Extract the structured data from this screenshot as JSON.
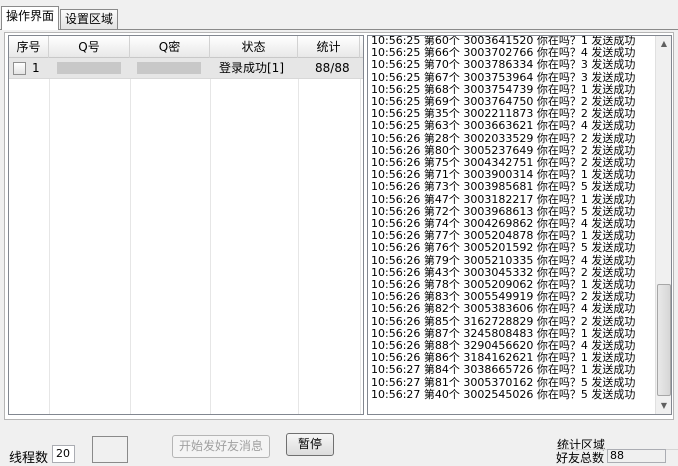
{
  "tabs": [
    {
      "label": "操作界面"
    },
    {
      "label": "设置区域"
    }
  ],
  "table": {
    "columns": [
      "序号",
      "Q号",
      "Q密",
      "状态",
      "统计"
    ],
    "rows": [
      {
        "index": "1",
        "status": "登录成功[1]",
        "count": "88/88"
      }
    ]
  },
  "log": {
    "lines": [
      "10:56:25 第60个 3003641520 你在吗？1 发送成功",
      "10:56:25 第66个 3003702766 你在吗？4 发送成功",
      "10:56:25 第70个 3003786334 你在吗？3 发送成功",
      "10:56:25 第67个 3003753964 你在吗？3 发送成功",
      "10:56:25 第68个 3003754739 你在吗？1 发送成功",
      "10:56:25 第69个 3003764750 你在吗？2 发送成功",
      "10:56:25 第35个 3002211873 你在吗？2 发送成功",
      "10:56:25 第63个 3003663621 你在吗？4 发送成功",
      "10:56:26 第28个 3002033529 你在吗？2 发送成功",
      "10:56:26 第80个 3005237649 你在吗？2 发送成功",
      "10:56:26 第75个 3004342751 你在吗？2 发送成功",
      "10:56:26 第71个 3003900314 你在吗？1 发送成功",
      "10:56:26 第73个 3003985681 你在吗？5 发送成功",
      "10:56:26 第47个 3003182217 你在吗？1 发送成功",
      "10:56:26 第72个 3003968613 你在吗？5 发送成功",
      "10:56:26 第74个 3004269862 你在吗？4 发送成功",
      "10:56:26 第77个 3005204878 你在吗？1 发送成功",
      "10:56:26 第76个 3005201592 你在吗？5 发送成功",
      "10:56:26 第79个 3005210335 你在吗？4 发送成功",
      "10:56:26 第43个 3003045332 你在吗？2 发送成功",
      "10:56:26 第78个 3005209062 你在吗？1 发送成功",
      "10:56:26 第83个 3005549919 你在吗？2 发送成功",
      "10:56:26 第82个 3005383606 你在吗？4 发送成功",
      "10:56:26 第85个 3162728829 你在吗？2 发送成功",
      "10:56:26 第87个 3245808483 你在吗？1 发送成功",
      "10:56:26 第88个 3290456620 你在吗？4 发送成功",
      "10:56:26 第86个 3184162621 你在吗？1 发送成功",
      "10:56:27 第84个 3038665726 你在吗？1 发送成功",
      "10:56:27 第81个 3005370162 你在吗？5 发送成功",
      "10:56:27 第40个 3002545026 你在吗？5 发送成功"
    ]
  },
  "controls": {
    "thread_label": "线程数",
    "thread_value": "20",
    "start_button": "开始发好友消息",
    "pause_button": "暂停",
    "stats_group": "统计区域",
    "friends_label": "好友总数",
    "friends_value": "88"
  },
  "icons": {
    "scroll_up": "▲",
    "scroll_down": "▼"
  }
}
